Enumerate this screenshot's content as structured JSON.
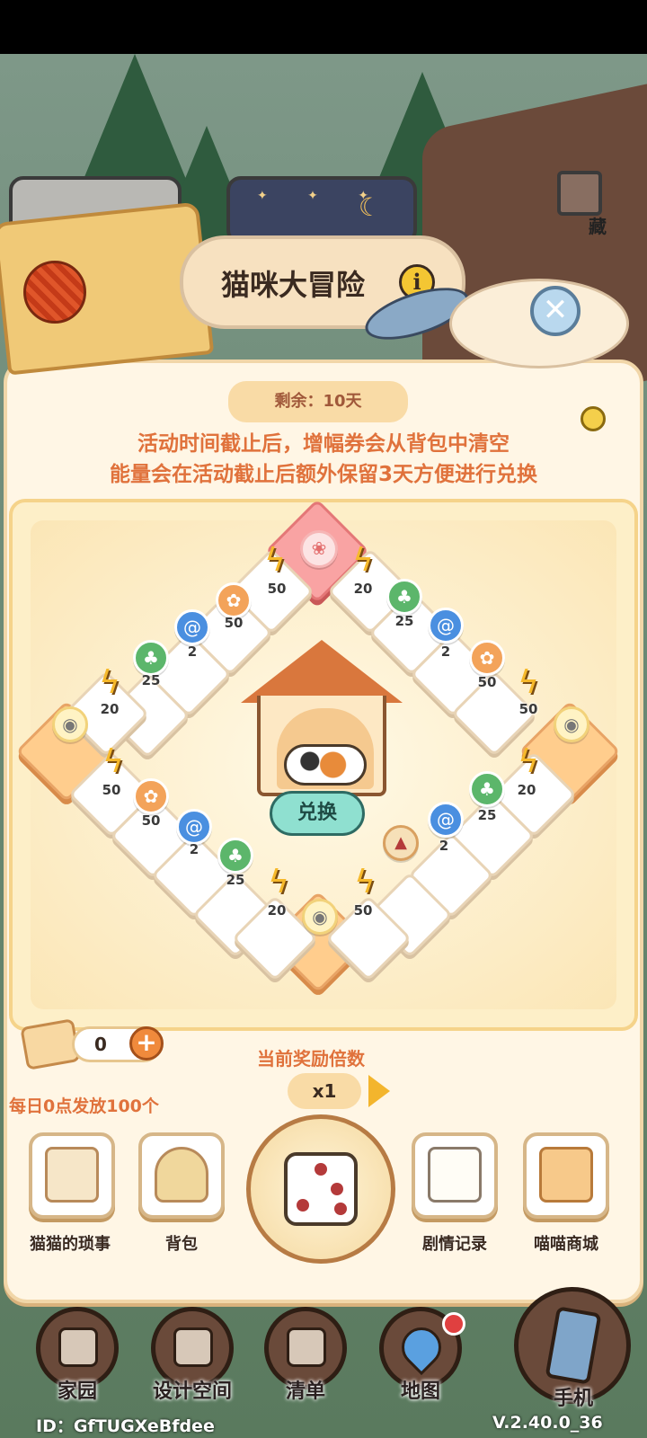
{
  "event": {
    "title": "猫咪大冒险",
    "remaining": "剩余：10天",
    "notice_line1": "活动时间截止后，增幅券会从背包中清空",
    "notice_line2": "能量会在活动截止后额外保留3天方便进行兑换"
  },
  "top_tabs": {
    "collect_label": "藏"
  },
  "board": {
    "exchange_label": "兑换",
    "tile_values": [
      "50",
      "20",
      "50",
      "25",
      "2",
      "2",
      "25",
      "50",
      "20",
      "50",
      "25",
      "20",
      "50",
      "25",
      "50",
      "2",
      "2",
      "25",
      "20",
      "50"
    ]
  },
  "controls": {
    "ticket_count": "0",
    "daily_note": "每日0点发放100个",
    "multiplier_label": "当前奖励倍数",
    "multiplier_value": "x1"
  },
  "features": [
    {
      "label": "猫猫的琐事",
      "icon": "notebook-quill-icon"
    },
    {
      "label": "背包",
      "icon": "backpack-icon"
    },
    {
      "label": "剧情记录",
      "icon": "story-record-icon"
    },
    {
      "label": "喵喵商城",
      "icon": "shop-icon"
    }
  ],
  "nav": [
    {
      "label": "家园",
      "icon": "home-icon"
    },
    {
      "label": "设计空间",
      "icon": "design-ruler-icon"
    },
    {
      "label": "清单",
      "icon": "checklist-icon"
    },
    {
      "label": "地图",
      "icon": "map-pin-icon"
    },
    {
      "label": "手机",
      "icon": "phone-icon"
    }
  ],
  "footer": {
    "user_id": "ID：GfTUGXeBfdee",
    "version": "V.2.40.0_36"
  },
  "colors": {
    "accent_orange": "#e0723c",
    "panel_bg": "#fff6e5",
    "token_green": "#5cb66b",
    "token_blue": "#4a8fe0",
    "token_orange": "#f3a35a",
    "bolt_yellow": "#f6b92b"
  }
}
